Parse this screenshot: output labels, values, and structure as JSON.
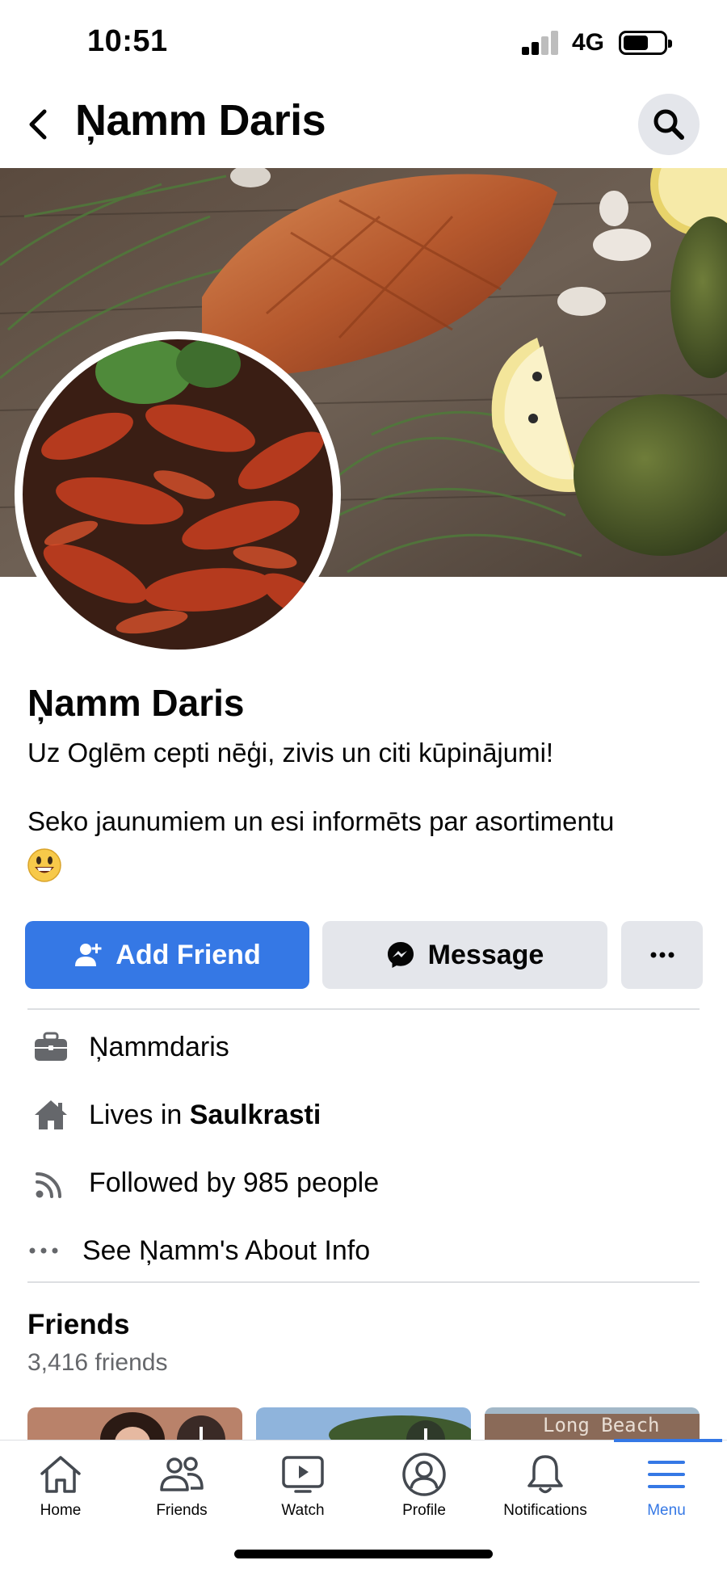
{
  "status_bar": {
    "time": "10:51",
    "network": "4G"
  },
  "header": {
    "title": "Ņamm Daris",
    "back_icon": "chevron-left-icon",
    "search_icon": "search-icon"
  },
  "profile": {
    "name": "Ņamm Daris",
    "bio_line1": "Uz Oglēm cepti nēģi, zivis un citi kūpinājumi!",
    "bio_line2": "Seko jaunumiem un esi informēts par asortimentu",
    "emoji": "smiley-emoji"
  },
  "actions": {
    "add_friend": "Add Friend",
    "message": "Message",
    "more": "···"
  },
  "details": {
    "work": "Ņammdaris",
    "lives_prefix": "Lives in ",
    "lives_place": "Saulkrasti",
    "followed": "Followed by 985 people",
    "about": "See Ņamm's About Info"
  },
  "friends": {
    "title": "Friends",
    "count": "3,416 friends",
    "thumb3_text": "Long Beach"
  },
  "tabbar": {
    "tabs": [
      {
        "label": "Home",
        "icon": "home-icon"
      },
      {
        "label": "Friends",
        "icon": "friends-icon"
      },
      {
        "label": "Watch",
        "icon": "watch-icon"
      },
      {
        "label": "Profile",
        "icon": "profile-icon"
      },
      {
        "label": "Notifications",
        "icon": "bell-icon"
      },
      {
        "label": "Menu",
        "icon": "menu-icon"
      }
    ],
    "active": "Menu"
  },
  "colors": {
    "brand": "#3578e5",
    "secondary_button": "#e4e6eb",
    "muted_text": "#65676b"
  }
}
